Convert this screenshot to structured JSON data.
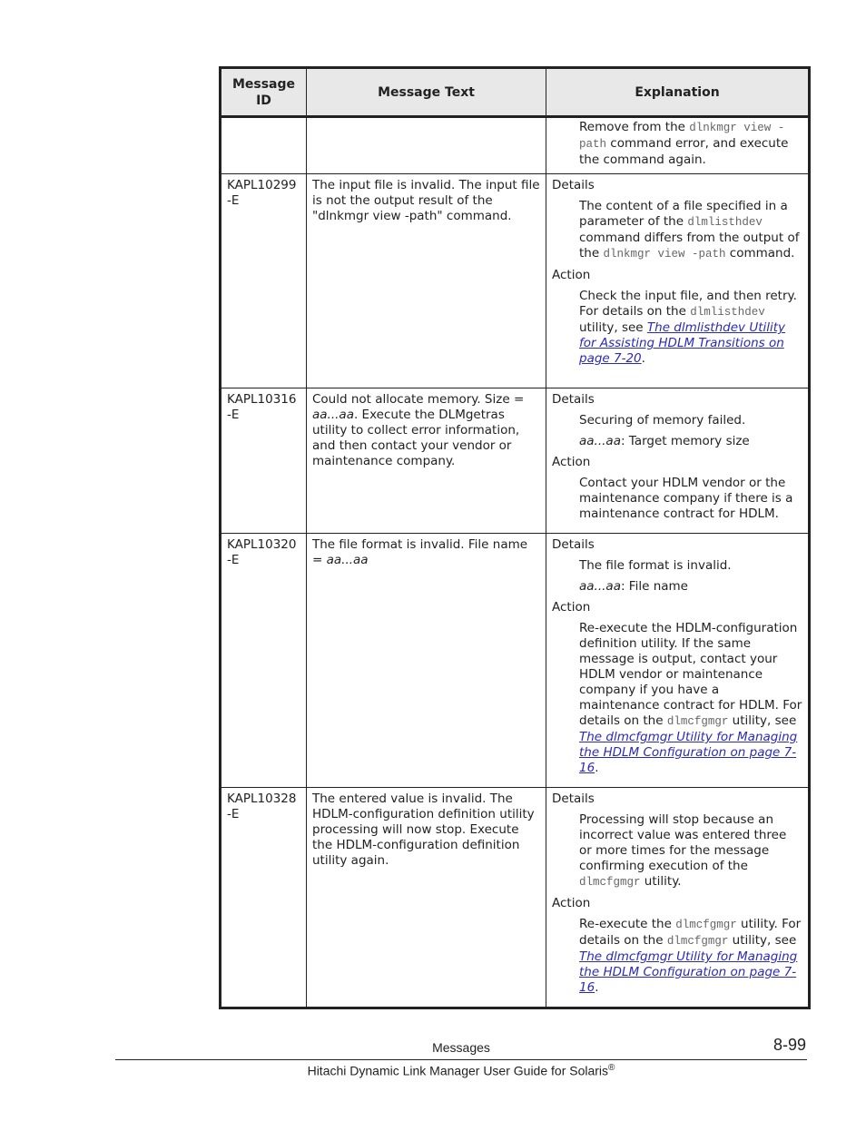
{
  "table": {
    "headers": [
      "Message ID",
      "Message Text",
      "Explanation"
    ],
    "continuation": {
      "explanation_parts": [
        "Remove from the ",
        "dlnkmgr view -path",
        " command error, and execute the command again."
      ]
    },
    "rows": [
      {
        "id": "KAPL10299 -E",
        "text": "The input file is invalid. The input file is not the output result of the \"dlnkmgr view -path\" command.",
        "details_label": "Details",
        "details": [
          "The content of a file specified in a parameter of the ",
          "dlmlisthdev",
          " command differs from the output of the ",
          "dlnkmgr view -path",
          " command."
        ],
        "action_label": "Action",
        "action": [
          "Check the input file, and then retry. For details on the ",
          "dlmlisthdev",
          " utility, see ",
          "The dlmlisthdev Utility for Assisting HDLM Transitions on page 7-20",
          "."
        ]
      },
      {
        "id": "KAPL10316 -E",
        "text_parts": [
          "Could not allocate memory. Size = ",
          "aa...aa",
          ". Execute the DLMgetras utility to collect error information, and then contact your vendor or maintenance company."
        ],
        "details_label": "Details",
        "details": [
          "Securing of memory failed."
        ],
        "details_var": [
          "aa...aa",
          ": Target memory size"
        ],
        "action_label": "Action",
        "action": [
          "Contact your HDLM vendor or the maintenance company if there is a maintenance contract for HDLM."
        ]
      },
      {
        "id": "KAPL10320 -E",
        "text_parts": [
          "The file format is invalid. File name = ",
          "aa...aa"
        ],
        "details_label": "Details",
        "details": [
          "The file format is invalid."
        ],
        "details_var": [
          "aa...aa",
          ": File name"
        ],
        "action_label": "Action",
        "action": [
          "Re-execute the HDLM-configuration definition utility. If the same message is output, contact your HDLM vendor or maintenance company if you have a maintenance contract for HDLM. For details on the ",
          "dlmcfgmgr",
          " utility, see ",
          "The dlmcfgmgr Utility for Managing the HDLM Configuration on page 7-16",
          "."
        ]
      },
      {
        "id": "KAPL10328 -E",
        "text": "The entered value is invalid. The HDLM-configuration definition utility processing will now stop. Execute the HDLM-configuration definition utility again.",
        "details_label": "Details",
        "details": [
          "Processing will stop because an incorrect value was entered three or more times for the message confirming execution of the ",
          "dlmcfgmgr",
          " utility."
        ],
        "action_label": "Action",
        "action": [
          "Re-execute the ",
          "dlmcfgmgr",
          " utility. For details on the ",
          "dlmcfgmgr",
          " utility, see ",
          "The dlmcfgmgr Utility for Managing the HDLM Configuration on page 7-16",
          "."
        ]
      }
    ]
  },
  "footer": {
    "section": "Messages",
    "page_number": "8-99",
    "book_title": "Hitachi Dynamic Link Manager User Guide for Solaris",
    "trademark": "®"
  },
  "colors": {
    "link": "#2a2ab8",
    "header_bg": "#e8e8e8",
    "code": "#666666"
  }
}
